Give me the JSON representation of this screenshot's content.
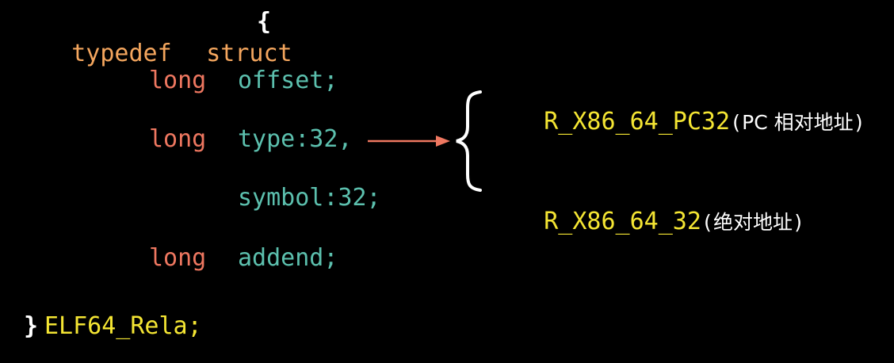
{
  "colors": {
    "background": "#000000",
    "keyword_typedef": "#f4a65e",
    "keyword_struct": "#f4a65e",
    "type_long": "#ee7760",
    "field": "#5cc0ae",
    "type_name": "#f4e533",
    "relocation": "#f4e533",
    "brace": "#ffffff",
    "arrow": "#ee7760",
    "annotation": "#ffffff"
  },
  "code": {
    "line1": {
      "typedef": "typedef",
      "struct": "struct",
      "open_brace": "{"
    },
    "line2": {
      "type": "long",
      "field": "offset;"
    },
    "line3": {
      "type": "long",
      "field": "type:32,"
    },
    "line4": {
      "field": "symbol:32;"
    },
    "line5": {
      "type": "long",
      "field": "addend;"
    },
    "line6": {
      "close_brace": "}",
      "name": "ELF64_Rela;"
    }
  },
  "relocations": [
    {
      "name": "R_X86_64_PC32",
      "note_open": "(",
      "note": "PC 相对地址",
      "note_close": ")"
    },
    {
      "name": "R_X86_64_32",
      "note_open": "(",
      "note": "绝对地址",
      "note_close": ")"
    }
  ]
}
